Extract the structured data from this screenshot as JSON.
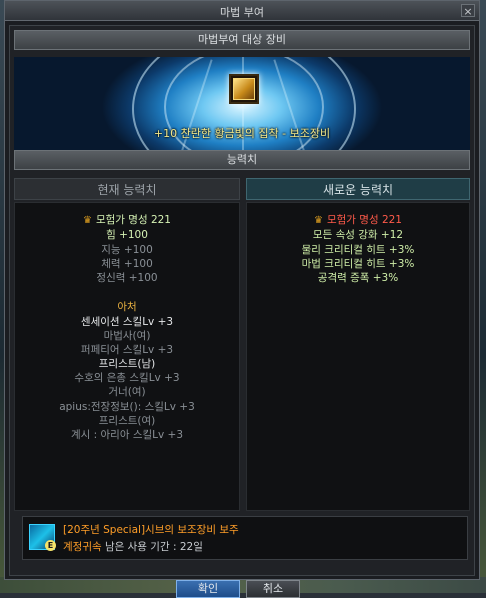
{
  "window": {
    "title": "마법 부여",
    "close_label": "×"
  },
  "target_section": {
    "header": "마법부여 대상 장비",
    "item_name": "+10 찬란한 황금빛의 집착 - 보조장비"
  },
  "stats_section": {
    "header": "능력치",
    "current": {
      "header": "현재 능력치",
      "fame": "모험가 명성 221",
      "lines": [
        "힘 +100",
        "지능 +100",
        "체력 +100",
        "정신력 +100"
      ],
      "set_title": "아처",
      "set_lines": [
        "센세이션 스킬Lv +3",
        "마법사(여)",
        "퍼페티어 스킬Lv +3",
        "프리스트(남)",
        "수호의 은총 스킬Lv +3",
        "거너(여)",
        "apius:전장정보(): 스킬Lv +3",
        "프리스트(여)",
        "계시 : 아리아 스킬Lv +3"
      ]
    },
    "new": {
      "header": "새로운 능력치",
      "fame": "모험가 명성 221",
      "lines": [
        "모든 속성 강화 +12",
        "물리 크리티컬 히트 +3%",
        "마법 크리티컬 히트 +3%",
        "공격력 증폭 +3%"
      ]
    }
  },
  "material": {
    "name": "[20주년 Special]시브의 보조장비 보주",
    "bound": "계정귀속",
    "remaining": "남은 사용 기간 : 22일"
  },
  "buttons": {
    "confirm": "확인",
    "cancel": "취소"
  },
  "colors": {
    "fame_current": "#d6f2b4",
    "fame_new": "#ff5a4a",
    "set_title": "#e8b040",
    "material_name": "#ff9e28"
  }
}
